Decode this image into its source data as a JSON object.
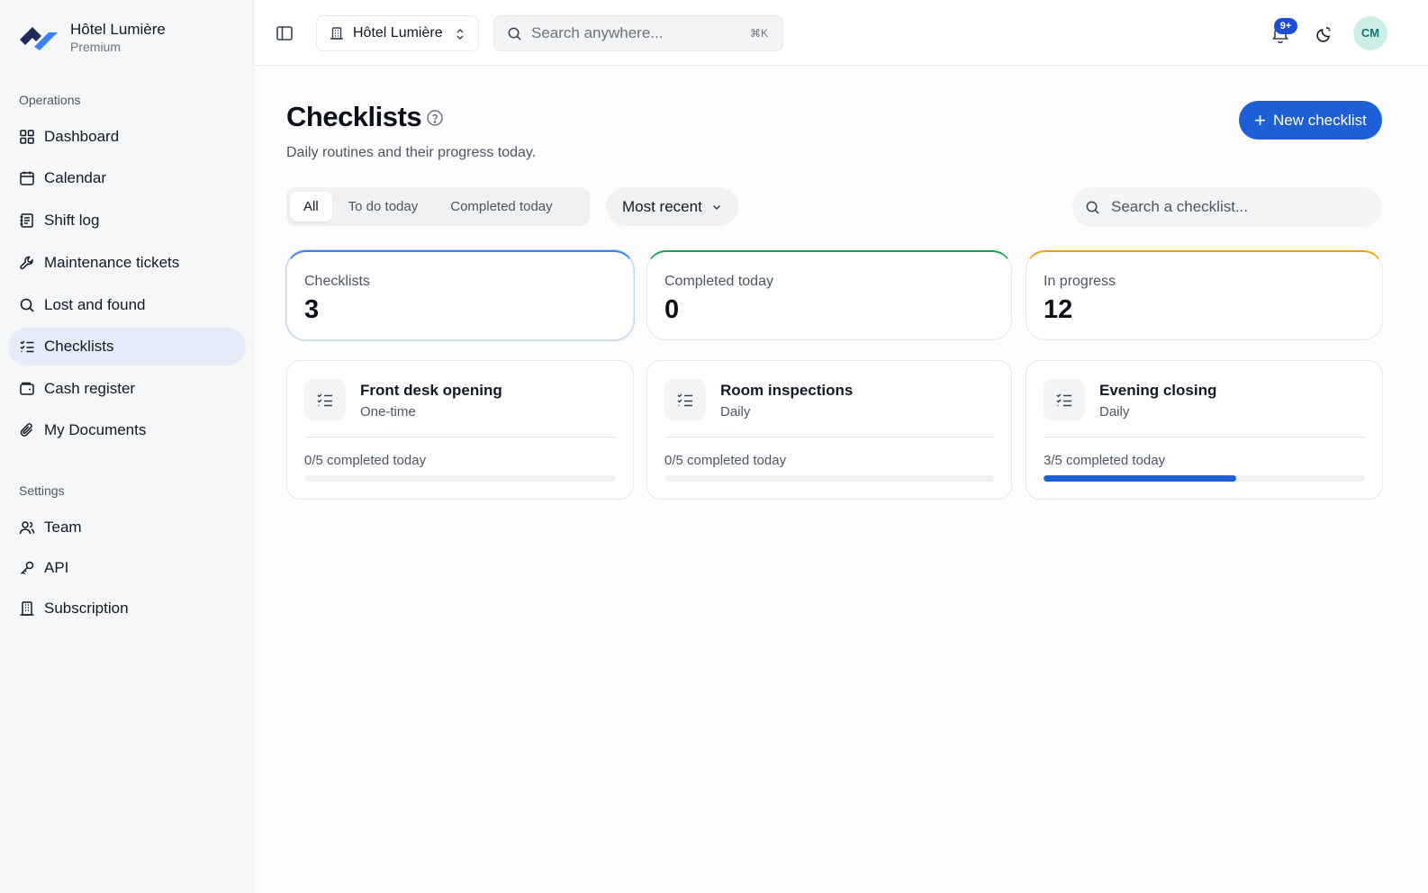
{
  "brand": {
    "name": "Hôtel Lumière",
    "plan": "Premium"
  },
  "sidebar": {
    "sections": [
      {
        "title": "Operations",
        "items": [
          {
            "label": "Dashboard",
            "icon": "grid-icon"
          },
          {
            "label": "Calendar",
            "icon": "calendar-icon"
          },
          {
            "label": "Shift log",
            "icon": "notebook-icon"
          },
          {
            "label": "Maintenance tickets",
            "icon": "wrench-icon"
          },
          {
            "label": "Lost and found",
            "icon": "search-icon"
          },
          {
            "label": "Checklists",
            "icon": "checklist-icon",
            "active": true
          },
          {
            "label": "Cash register",
            "icon": "wallet-icon"
          },
          {
            "label": "My Documents",
            "icon": "paperclip-icon"
          }
        ]
      },
      {
        "title": "Settings",
        "items": [
          {
            "label": "Team",
            "icon": "users-icon"
          },
          {
            "label": "API",
            "icon": "key-icon"
          },
          {
            "label": "Subscription",
            "icon": "building-icon"
          }
        ]
      }
    ]
  },
  "topbar": {
    "hotel_selector": "Hôtel Lumière",
    "search_placeholder": "Search anywhere...",
    "search_shortcut": "⌘K",
    "notifications_badge": "9+",
    "avatar_initials": "CM"
  },
  "main": {
    "title": "Checklists",
    "subtitle": "Daily routines and their progress today.",
    "new_button": "New checklist",
    "tabs": [
      {
        "label": "All",
        "active": true
      },
      {
        "label": "To do today"
      },
      {
        "label": "Completed today"
      }
    ],
    "sort_label": "Most recent",
    "list_search_placeholder": "Search a checklist...",
    "stats": [
      {
        "label": "Checklists",
        "value": "3",
        "accent": "#3b82f6"
      },
      {
        "label": "Completed today",
        "value": "0",
        "accent": "#16a34a"
      },
      {
        "label": "In progress",
        "value": "12",
        "accent": "#f59e0b"
      }
    ],
    "checklists": [
      {
        "title": "Front desk opening",
        "frequency": "One-time",
        "progress_text": "0/5 completed today",
        "progress": 0.0
      },
      {
        "title": "Room inspections",
        "frequency": "Daily",
        "progress_text": "0/5 completed today",
        "progress": 0.0
      },
      {
        "title": "Evening closing",
        "frequency": "Daily",
        "progress_text": "3/5 completed today",
        "progress": 0.6
      }
    ]
  },
  "colors": {
    "accent": "#1f5fd6",
    "active_nav": "#e5ecf7"
  }
}
